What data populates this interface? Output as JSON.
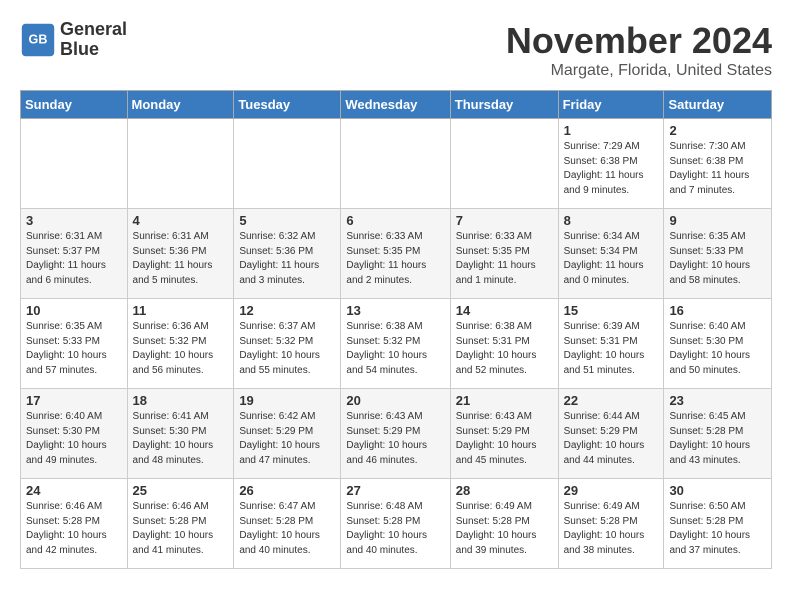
{
  "logo": {
    "line1": "General",
    "line2": "Blue"
  },
  "title": "November 2024",
  "location": "Margate, Florida, United States",
  "days_of_week": [
    "Sunday",
    "Monday",
    "Tuesday",
    "Wednesday",
    "Thursday",
    "Friday",
    "Saturday"
  ],
  "weeks": [
    [
      {
        "day": "",
        "info": ""
      },
      {
        "day": "",
        "info": ""
      },
      {
        "day": "",
        "info": ""
      },
      {
        "day": "",
        "info": ""
      },
      {
        "day": "",
        "info": ""
      },
      {
        "day": "1",
        "info": "Sunrise: 7:29 AM\nSunset: 6:38 PM\nDaylight: 11 hours and 9 minutes."
      },
      {
        "day": "2",
        "info": "Sunrise: 7:30 AM\nSunset: 6:38 PM\nDaylight: 11 hours and 7 minutes."
      }
    ],
    [
      {
        "day": "3",
        "info": "Sunrise: 6:31 AM\nSunset: 5:37 PM\nDaylight: 11 hours and 6 minutes."
      },
      {
        "day": "4",
        "info": "Sunrise: 6:31 AM\nSunset: 5:36 PM\nDaylight: 11 hours and 5 minutes."
      },
      {
        "day": "5",
        "info": "Sunrise: 6:32 AM\nSunset: 5:36 PM\nDaylight: 11 hours and 3 minutes."
      },
      {
        "day": "6",
        "info": "Sunrise: 6:33 AM\nSunset: 5:35 PM\nDaylight: 11 hours and 2 minutes."
      },
      {
        "day": "7",
        "info": "Sunrise: 6:33 AM\nSunset: 5:35 PM\nDaylight: 11 hours and 1 minute."
      },
      {
        "day": "8",
        "info": "Sunrise: 6:34 AM\nSunset: 5:34 PM\nDaylight: 11 hours and 0 minutes."
      },
      {
        "day": "9",
        "info": "Sunrise: 6:35 AM\nSunset: 5:33 PM\nDaylight: 10 hours and 58 minutes."
      }
    ],
    [
      {
        "day": "10",
        "info": "Sunrise: 6:35 AM\nSunset: 5:33 PM\nDaylight: 10 hours and 57 minutes."
      },
      {
        "day": "11",
        "info": "Sunrise: 6:36 AM\nSunset: 5:32 PM\nDaylight: 10 hours and 56 minutes."
      },
      {
        "day": "12",
        "info": "Sunrise: 6:37 AM\nSunset: 5:32 PM\nDaylight: 10 hours and 55 minutes."
      },
      {
        "day": "13",
        "info": "Sunrise: 6:38 AM\nSunset: 5:32 PM\nDaylight: 10 hours and 54 minutes."
      },
      {
        "day": "14",
        "info": "Sunrise: 6:38 AM\nSunset: 5:31 PM\nDaylight: 10 hours and 52 minutes."
      },
      {
        "day": "15",
        "info": "Sunrise: 6:39 AM\nSunset: 5:31 PM\nDaylight: 10 hours and 51 minutes."
      },
      {
        "day": "16",
        "info": "Sunrise: 6:40 AM\nSunset: 5:30 PM\nDaylight: 10 hours and 50 minutes."
      }
    ],
    [
      {
        "day": "17",
        "info": "Sunrise: 6:40 AM\nSunset: 5:30 PM\nDaylight: 10 hours and 49 minutes."
      },
      {
        "day": "18",
        "info": "Sunrise: 6:41 AM\nSunset: 5:30 PM\nDaylight: 10 hours and 48 minutes."
      },
      {
        "day": "19",
        "info": "Sunrise: 6:42 AM\nSunset: 5:29 PM\nDaylight: 10 hours and 47 minutes."
      },
      {
        "day": "20",
        "info": "Sunrise: 6:43 AM\nSunset: 5:29 PM\nDaylight: 10 hours and 46 minutes."
      },
      {
        "day": "21",
        "info": "Sunrise: 6:43 AM\nSunset: 5:29 PM\nDaylight: 10 hours and 45 minutes."
      },
      {
        "day": "22",
        "info": "Sunrise: 6:44 AM\nSunset: 5:29 PM\nDaylight: 10 hours and 44 minutes."
      },
      {
        "day": "23",
        "info": "Sunrise: 6:45 AM\nSunset: 5:28 PM\nDaylight: 10 hours and 43 minutes."
      }
    ],
    [
      {
        "day": "24",
        "info": "Sunrise: 6:46 AM\nSunset: 5:28 PM\nDaylight: 10 hours and 42 minutes."
      },
      {
        "day": "25",
        "info": "Sunrise: 6:46 AM\nSunset: 5:28 PM\nDaylight: 10 hours and 41 minutes."
      },
      {
        "day": "26",
        "info": "Sunrise: 6:47 AM\nSunset: 5:28 PM\nDaylight: 10 hours and 40 minutes."
      },
      {
        "day": "27",
        "info": "Sunrise: 6:48 AM\nSunset: 5:28 PM\nDaylight: 10 hours and 40 minutes."
      },
      {
        "day": "28",
        "info": "Sunrise: 6:49 AM\nSunset: 5:28 PM\nDaylight: 10 hours and 39 minutes."
      },
      {
        "day": "29",
        "info": "Sunrise: 6:49 AM\nSunset: 5:28 PM\nDaylight: 10 hours and 38 minutes."
      },
      {
        "day": "30",
        "info": "Sunrise: 6:50 AM\nSunset: 5:28 PM\nDaylight: 10 hours and 37 minutes."
      }
    ]
  ]
}
